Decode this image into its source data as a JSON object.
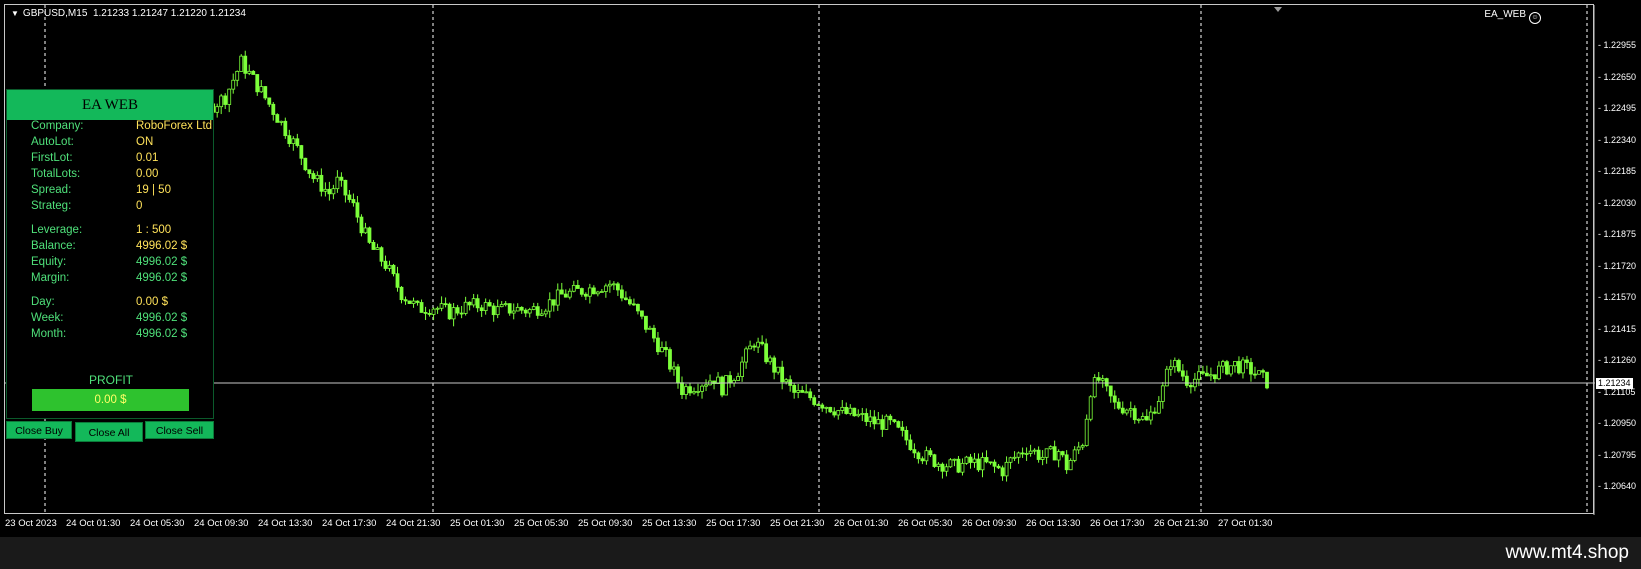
{
  "chart": {
    "symbol": "GBPUSD,M15",
    "quote": "1.21233 1.21247 1.21220 1.21234",
    "ea_name": "EA_WEB",
    "current_price": "1.21234",
    "price_labels": [
      "1.22955",
      "1.22650",
      "1.22495",
      "1.22340",
      "1.22185",
      "1.22030",
      "1.21875",
      "1.21720",
      "1.21570",
      "1.21415",
      "1.21260",
      "1.21105",
      "1.20950",
      "1.20795",
      "1.20640"
    ],
    "time_labels": [
      "23 Oct 2023",
      "24 Oct 01:30",
      "24 Oct 05:30",
      "24 Oct 09:30",
      "24 Oct 13:30",
      "24 Oct 17:30",
      "24 Oct 21:30",
      "25 Oct 01:30",
      "25 Oct 05:30",
      "25 Oct 09:30",
      "25 Oct 13:30",
      "25 Oct 17:30",
      "25 Oct 21:30",
      "26 Oct 01:30",
      "26 Oct 05:30",
      "26 Oct 09:30",
      "26 Oct 13:30",
      "26 Oct 17:30",
      "26 Oct 21:30",
      "27 Oct 01:30"
    ],
    "colors": {
      "candle": "#7cff3a",
      "background": "#000000",
      "grid": "#ffffff"
    },
    "close_path": [
      [
        0,
        1.224
      ],
      [
        8,
        1.225
      ],
      [
        14,
        1.2262
      ],
      [
        16,
        1.227
      ],
      [
        20,
        1.2266
      ],
      [
        25,
        1.2265
      ],
      [
        30,
        1.2272
      ],
      [
        34,
        1.229
      ],
      [
        38,
        1.2278
      ],
      [
        42,
        1.2265
      ],
      [
        48,
        1.2245
      ],
      [
        52,
        1.223
      ],
      [
        56,
        1.2222
      ],
      [
        58,
        1.2228
      ],
      [
        62,
        1.2215
      ],
      [
        66,
        1.2195
      ],
      [
        70,
        1.2185
      ],
      [
        74,
        1.217
      ],
      [
        78,
        1.2162
      ],
      [
        82,
        1.2163
      ],
      [
        86,
        1.216
      ],
      [
        90,
        1.2163
      ],
      [
        94,
        1.2164
      ],
      [
        98,
        1.2161
      ],
      [
        102,
        1.2162
      ],
      [
        106,
        1.2161
      ],
      [
        110,
        1.2164
      ],
      [
        114,
        1.2169
      ],
      [
        118,
        1.2171
      ],
      [
        122,
        1.2173
      ],
      [
        126,
        1.2175
      ],
      [
        128,
        1.2172
      ],
      [
        132,
        1.2162
      ],
      [
        136,
        1.215
      ],
      [
        140,
        1.2137
      ],
      [
        144,
        1.212
      ],
      [
        148,
        1.2123
      ],
      [
        152,
        1.2126
      ],
      [
        154,
        1.2121
      ],
      [
        158,
        1.213
      ],
      [
        162,
        1.2145
      ],
      [
        164,
        1.214
      ],
      [
        168,
        1.2128
      ],
      [
        172,
        1.2118
      ],
      [
        176,
        1.2116
      ],
      [
        180,
        1.2112
      ],
      [
        184,
        1.2108
      ],
      [
        188,
        1.2106
      ],
      [
        192,
        1.2103
      ],
      [
        196,
        1.2102
      ],
      [
        200,
        1.2094
      ],
      [
        204,
        1.2086
      ],
      [
        208,
        1.2082
      ],
      [
        212,
        1.208
      ],
      [
        216,
        1.2082
      ],
      [
        220,
        1.2081
      ],
      [
        224,
        1.2078
      ],
      [
        226,
        1.2083
      ],
      [
        230,
        1.209
      ],
      [
        234,
        1.2085
      ],
      [
        238,
        1.2088
      ],
      [
        240,
        1.208
      ],
      [
        244,
        1.2093
      ],
      [
        246,
        1.212
      ],
      [
        248,
        1.2125
      ],
      [
        252,
        1.2112
      ],
      [
        256,
        1.211
      ],
      [
        260,
        1.2103
      ],
      [
        264,
        1.212
      ],
      [
        266,
        1.2135
      ],
      [
        270,
        1.2125
      ],
      [
        274,
        1.2126
      ],
      [
        278,
        1.213
      ],
      [
        282,
        1.2133
      ],
      [
        286,
        1.213
      ],
      [
        290,
        1.2124
      ]
    ]
  },
  "panel": {
    "title": "EA WEB",
    "rows": [
      {
        "k": "Company:",
        "v": "RoboForex Ltd"
      },
      {
        "k": "AutoLot:",
        "v": "ON"
      },
      {
        "k": "FirstLot:",
        "v": "0.01"
      },
      {
        "k": "TotalLots:",
        "v": "0.00"
      },
      {
        "k": "Spread:",
        "v": "19  |  50"
      },
      {
        "k": "Strateg:",
        "v": "0"
      },
      {
        "k": "Leverage:",
        "v": "1 : 500"
      },
      {
        "k": "Balance:",
        "v": "4996.02 $"
      },
      {
        "k": "Equity:",
        "v": "4996.02 $"
      },
      {
        "k": "Margin:",
        "v": "4996.02 $"
      },
      {
        "k": "Day:",
        "v": "0.00 $"
      },
      {
        "k": "Week:",
        "v": "4996.02 $"
      },
      {
        "k": "Month:",
        "v": "4996.02 $"
      }
    ],
    "profit_label": "PROFIT",
    "profit_value": "0.00 $",
    "buttons": {
      "close_buy": "Close Buy",
      "close_all": "Close All",
      "close_sell": "Close Sell"
    }
  },
  "footer": {
    "brand": "www.mt4.shop"
  }
}
